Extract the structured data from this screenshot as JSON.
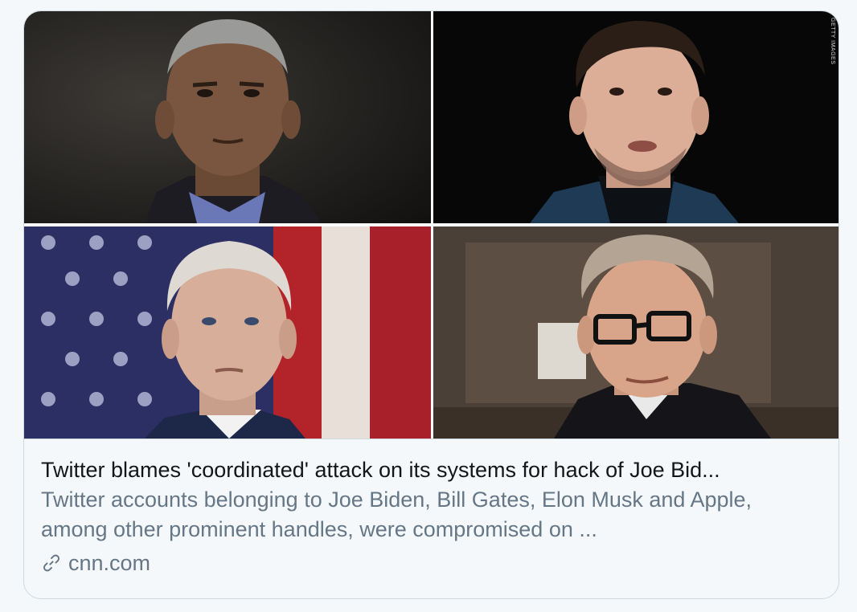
{
  "card": {
    "headline": "Twitter blames 'coordinated' attack on its systems for hack of Joe Bid...",
    "description": "Twitter accounts belonging to Joe Biden, Bill Gates, Elon Musk and Apple, among other prominent handles, were compromised on ...",
    "domain": "cnn.com",
    "photo_credit": "GETTY IMAGES"
  },
  "icons": {
    "link": "link-icon"
  },
  "colors": {
    "headline": "#14171a",
    "secondary_text": "#657786",
    "border": "#cfd9de",
    "background": "#f5f8fa"
  }
}
